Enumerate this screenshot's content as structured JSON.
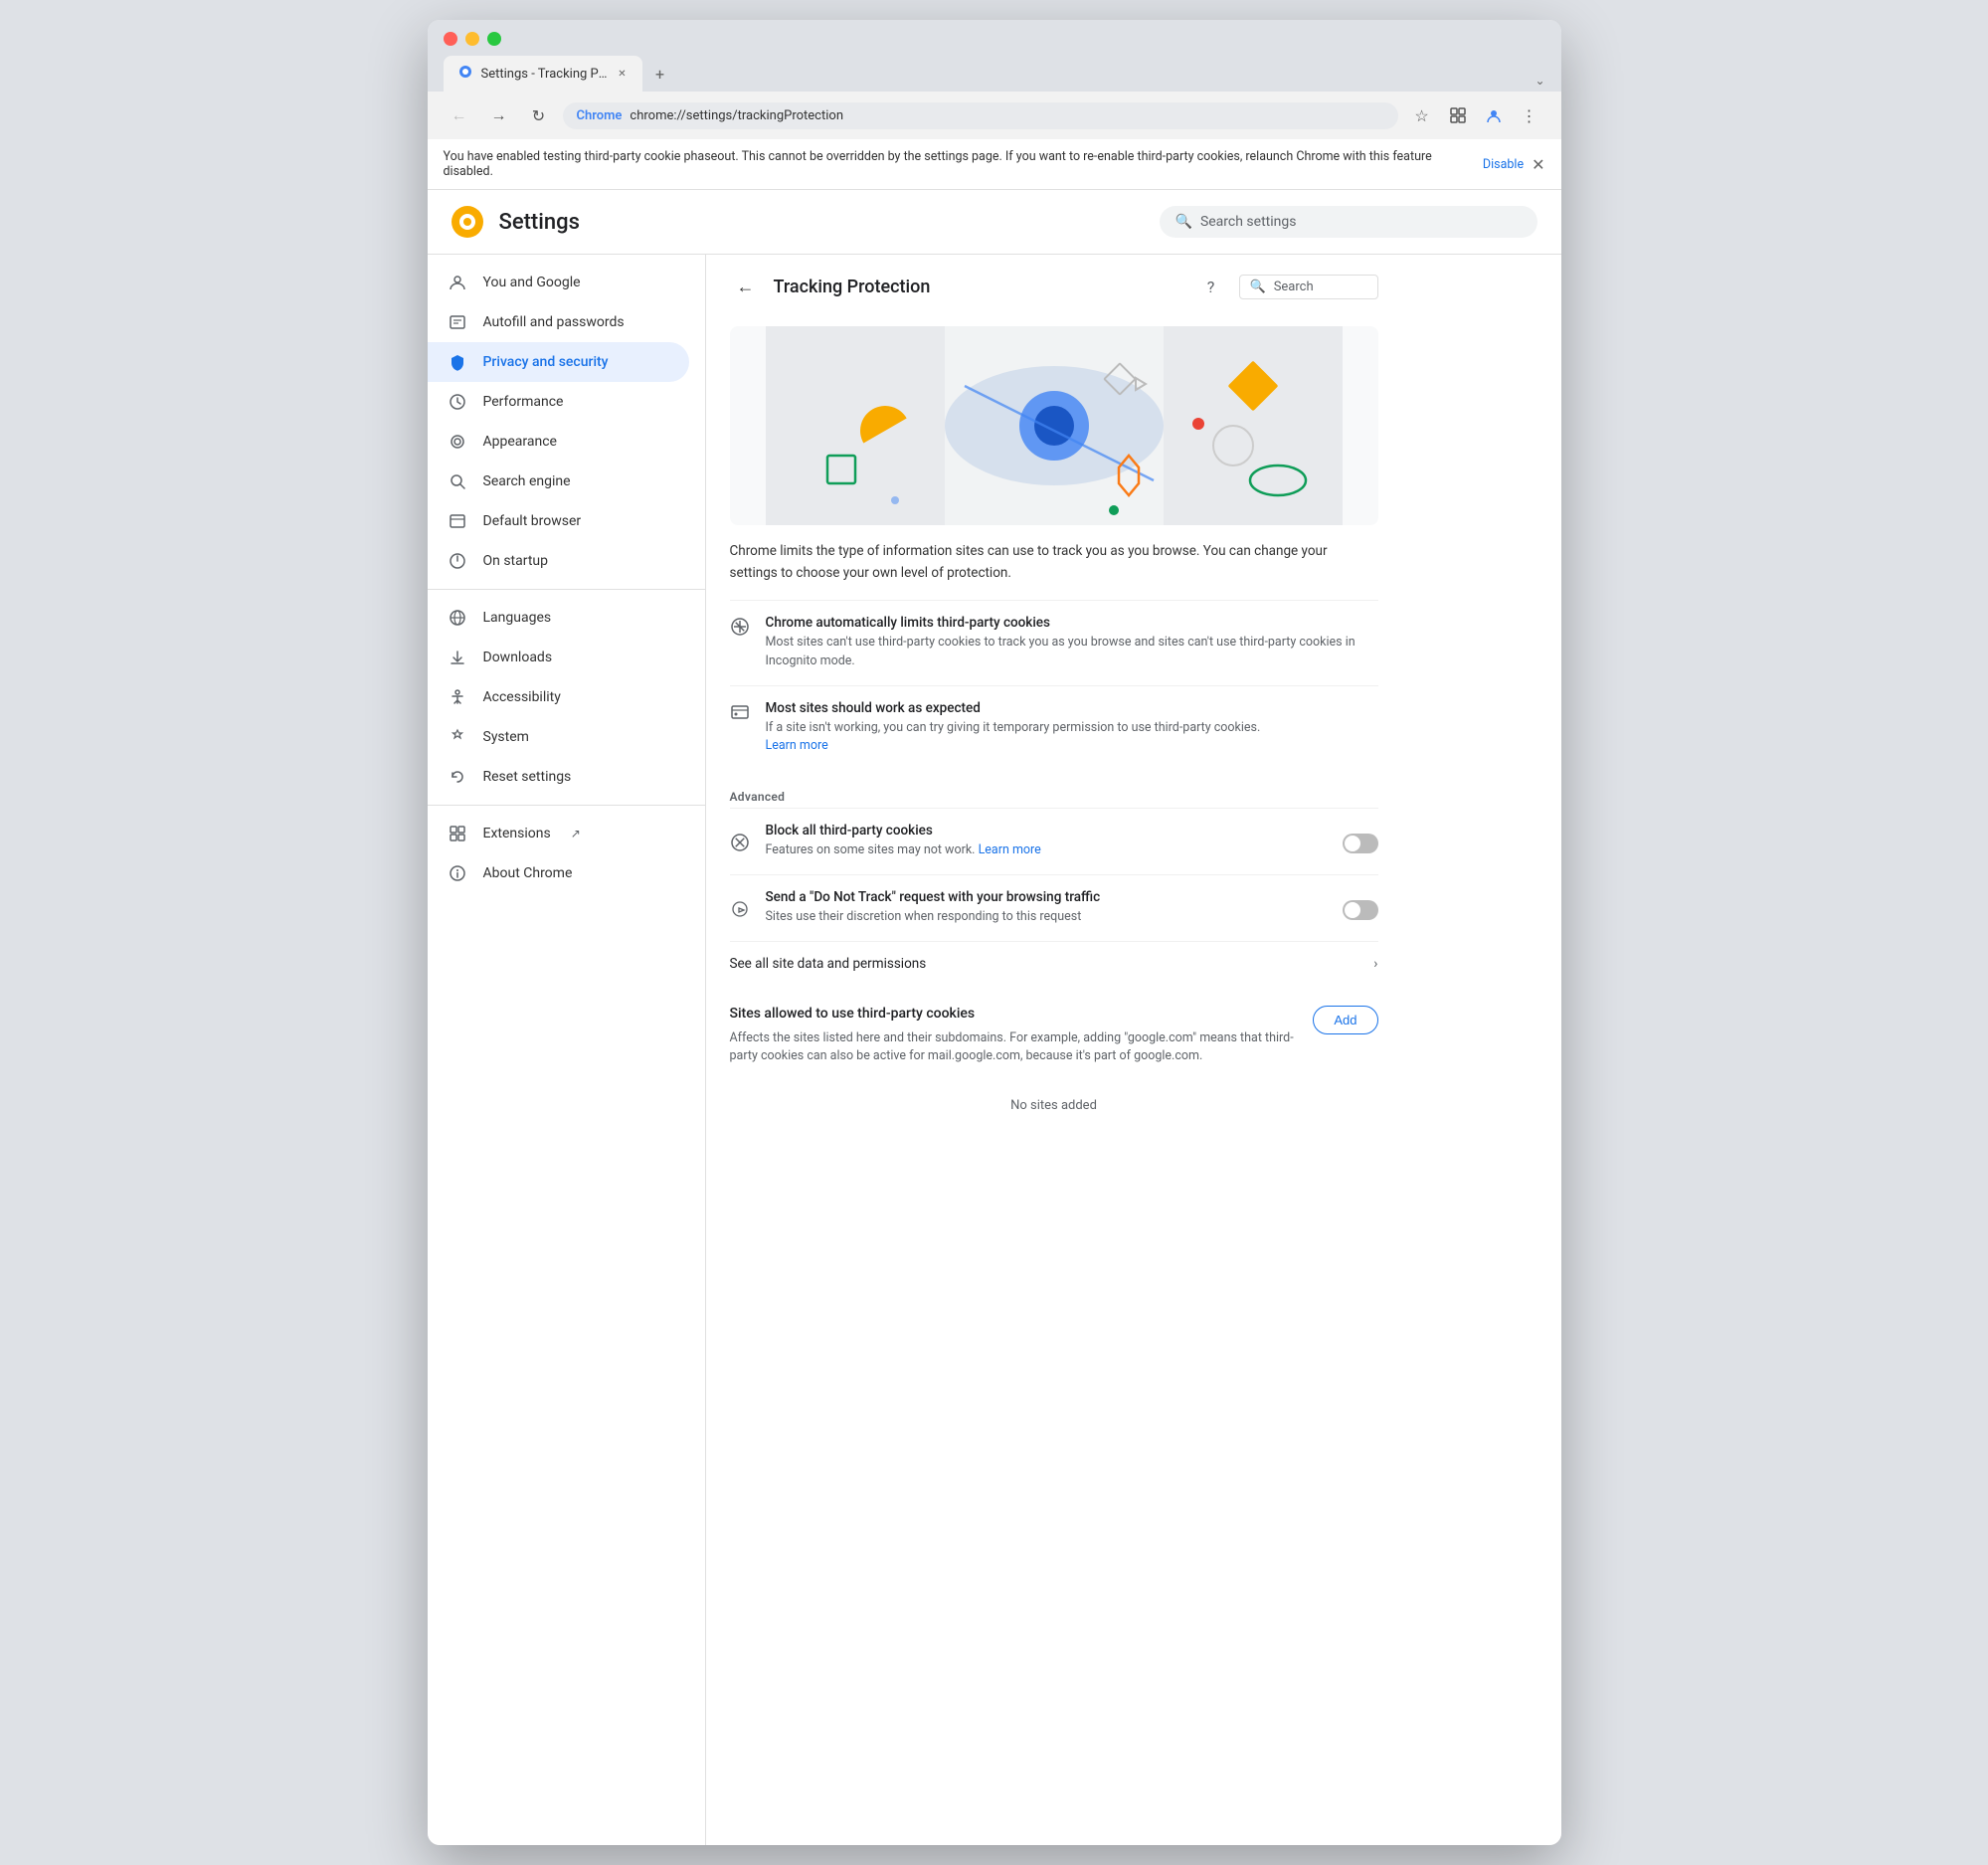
{
  "browser": {
    "title": "Settings - Tracking Protection",
    "tab_label": "Settings - Tracking Protection",
    "url_prefix": "Chrome",
    "url": "chrome://settings/trackingProtection",
    "new_tab_symbol": "+",
    "expand_symbol": "⌄"
  },
  "banner": {
    "text": "You have enabled testing third-party cookie phaseout. This cannot be overridden by the settings page. If you want to re-enable third-party cookies, relaunch Chrome with this feature disabled.",
    "disable_link": "Disable"
  },
  "settings": {
    "logo_symbol": "⚙",
    "title": "Settings",
    "search_placeholder": "Search settings"
  },
  "sidebar": {
    "items": [
      {
        "id": "you-and-google",
        "label": "You and Google",
        "icon": "👤"
      },
      {
        "id": "autofill",
        "label": "Autofill and passwords",
        "icon": "📋"
      },
      {
        "id": "privacy",
        "label": "Privacy and security",
        "icon": "🔒",
        "active": true
      },
      {
        "id": "performance",
        "label": "Performance",
        "icon": "⚡"
      },
      {
        "id": "appearance",
        "label": "Appearance",
        "icon": "🎨"
      },
      {
        "id": "search-engine",
        "label": "Search engine",
        "icon": "🔍"
      },
      {
        "id": "default-browser",
        "label": "Default browser",
        "icon": "🖥"
      },
      {
        "id": "on-startup",
        "label": "On startup",
        "icon": "⏻"
      }
    ],
    "items2": [
      {
        "id": "languages",
        "label": "Languages",
        "icon": "🌐"
      },
      {
        "id": "downloads",
        "label": "Downloads",
        "icon": "⬇"
      },
      {
        "id": "accessibility",
        "label": "Accessibility",
        "icon": "♿"
      },
      {
        "id": "system",
        "label": "System",
        "icon": "🔧"
      },
      {
        "id": "reset-settings",
        "label": "Reset settings",
        "icon": "↺"
      }
    ],
    "items3": [
      {
        "id": "extensions",
        "label": "Extensions",
        "icon": "🧩",
        "external": true
      },
      {
        "id": "about-chrome",
        "label": "About Chrome",
        "icon": "ℹ"
      }
    ]
  },
  "main": {
    "back_label": "←",
    "page_title": "Tracking Protection",
    "search_placeholder": "Search",
    "description": "Chrome limits the type of information sites can use to track you as you browse. You can change your settings to choose your own level of protection.",
    "option1_title": "Chrome automatically limits third-party cookies",
    "option1_desc": "Most sites can't use third-party cookies to track you as you browse and sites can't use third-party cookies in Incognito mode.",
    "option2_title": "Most sites should work as expected",
    "option2_desc": "If a site isn't working, you can try giving it temporary permission to use third-party cookies.",
    "option2_link": "Learn more",
    "advanced_label": "Advanced",
    "toggle1_title": "Block all third-party cookies",
    "toggle1_desc": "Features on some sites may not work.",
    "toggle1_link": "Learn more",
    "toggle1_on": false,
    "toggle2_title": "Send a \"Do Not Track\" request with your browsing traffic",
    "toggle2_desc": "Sites use their discretion when responding to this request",
    "toggle2_on": false,
    "site_data_label": "See all site data and permissions",
    "sites_title": "Sites allowed to use third-party cookies",
    "sites_desc": "Affects the sites listed here and their subdomains. For example, adding \"google.com\" means that third-party cookies can also be active for mail.google.com, because it's part of google.com.",
    "add_btn_label": "Add",
    "no_sites_label": "No sites added"
  }
}
